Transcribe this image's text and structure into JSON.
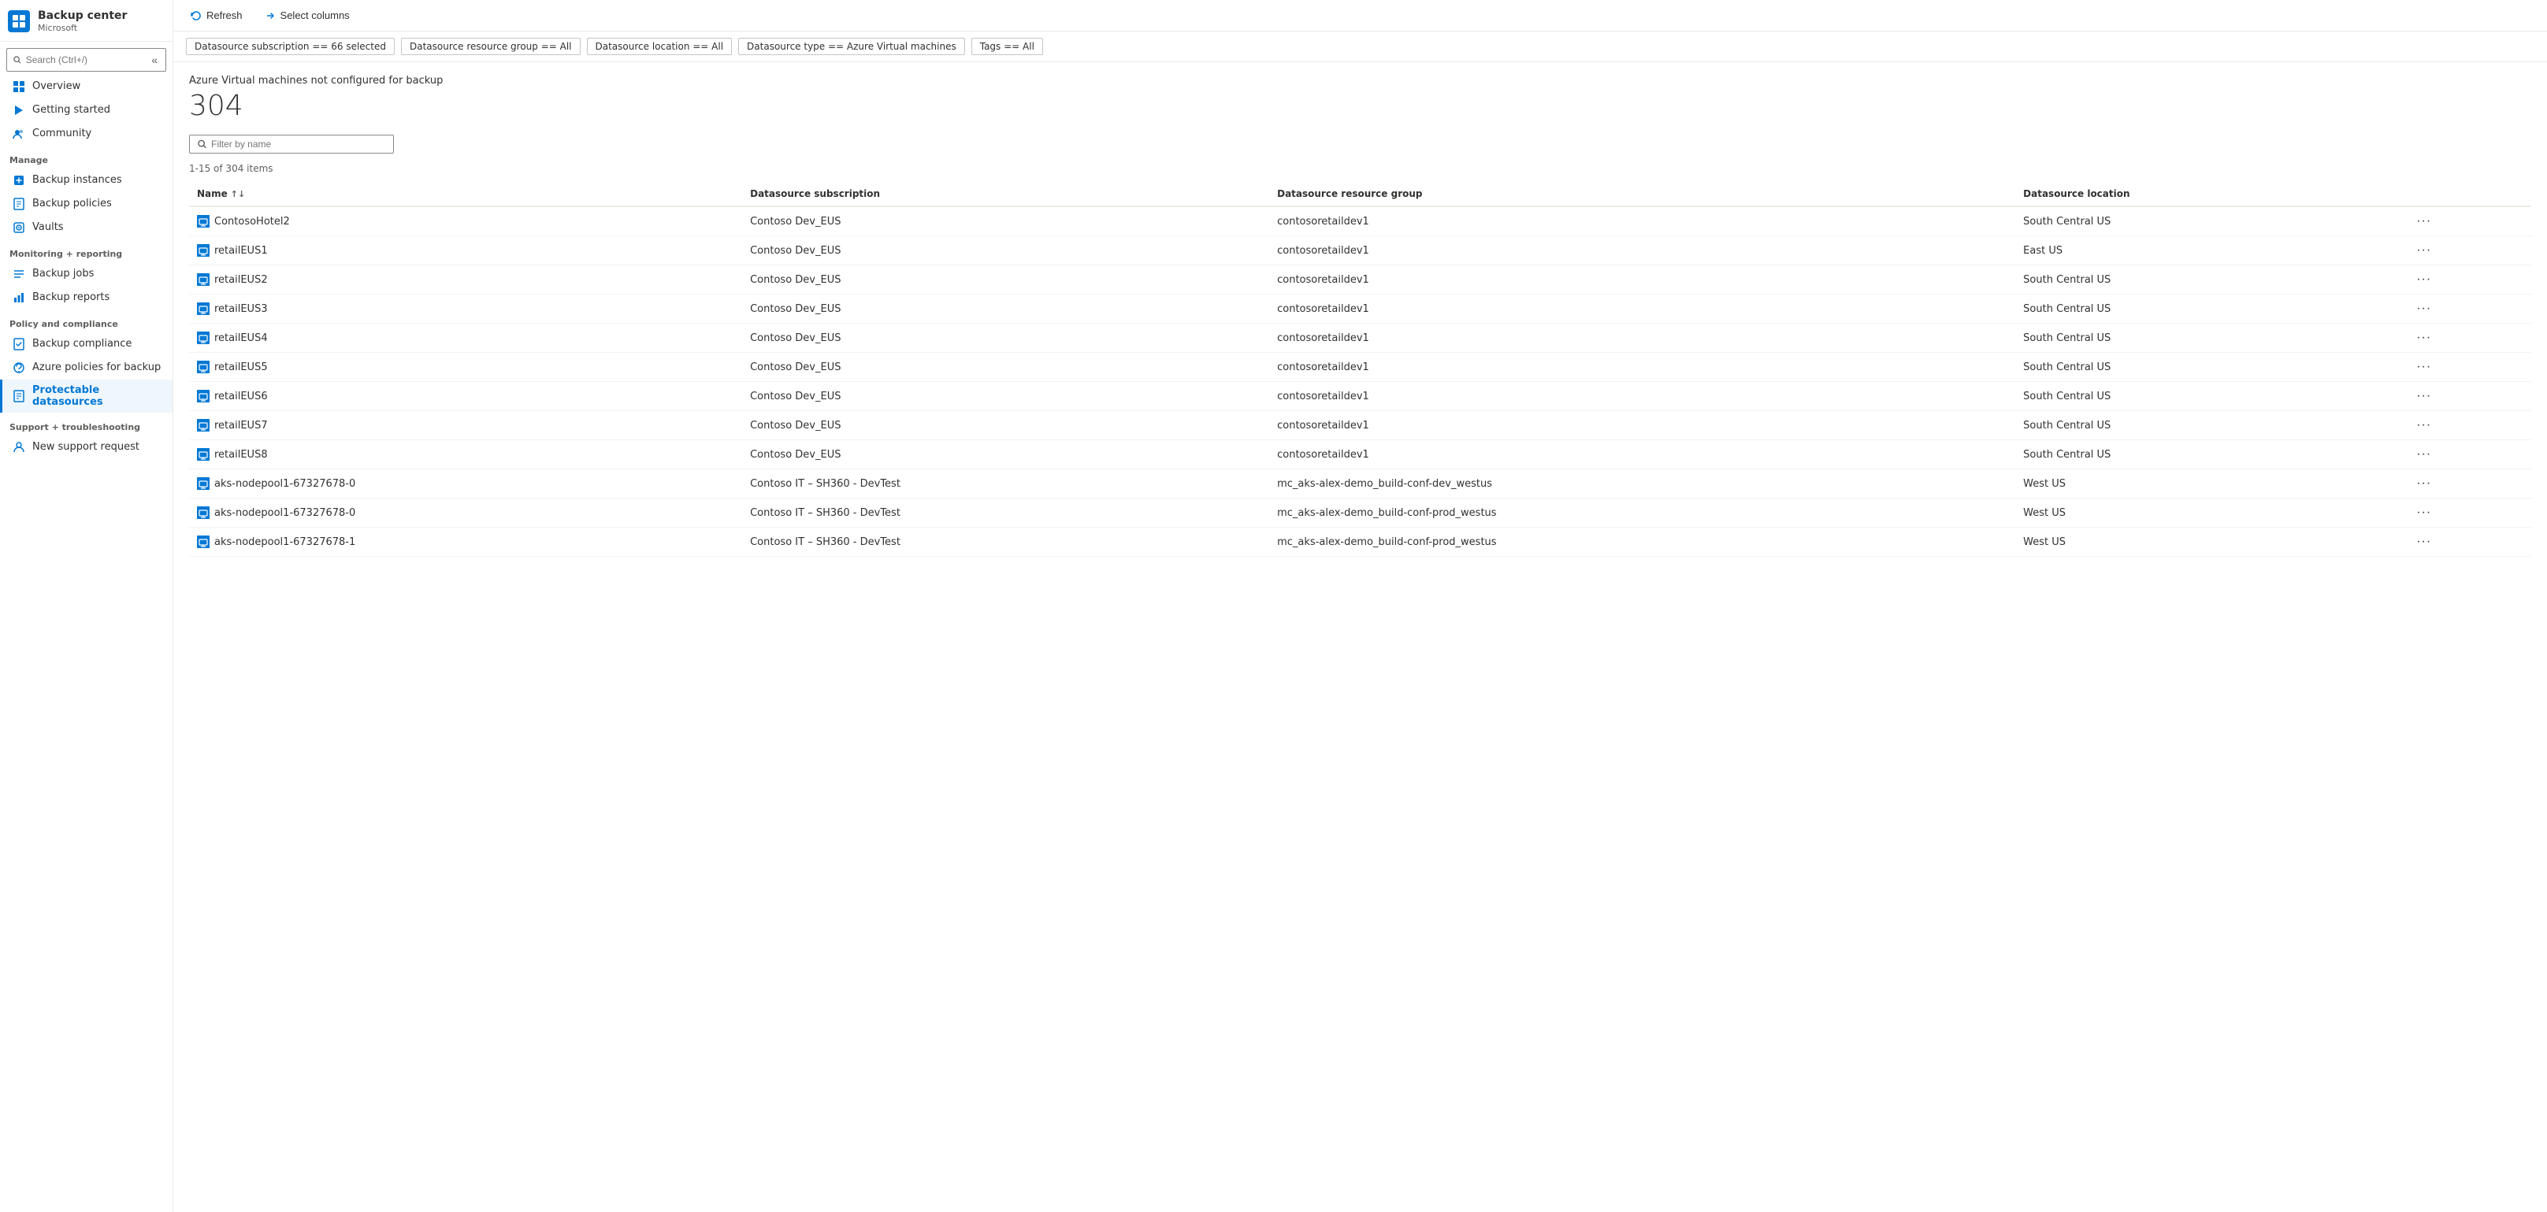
{
  "header": {
    "app_name": "Backup center",
    "page_title": "Protectable datasources",
    "app_subtitle": "Microsoft",
    "more_label": "···",
    "close_label": "✕"
  },
  "sidebar": {
    "search_placeholder": "Search (Ctrl+/)",
    "collapse_icon": "«",
    "sections": [
      {
        "items": [
          {
            "id": "overview",
            "label": "Overview",
            "icon": "⊞"
          },
          {
            "id": "getting-started",
            "label": "Getting started",
            "icon": "🚀"
          },
          {
            "id": "community",
            "label": "Community",
            "icon": "👥"
          }
        ]
      },
      {
        "label": "Manage",
        "items": [
          {
            "id": "backup-instances",
            "label": "Backup instances",
            "icon": "☁"
          },
          {
            "id": "backup-policies",
            "label": "Backup policies",
            "icon": "📋"
          },
          {
            "id": "vaults",
            "label": "Vaults",
            "icon": "🏦"
          }
        ]
      },
      {
        "label": "Monitoring + reporting",
        "items": [
          {
            "id": "backup-jobs",
            "label": "Backup jobs",
            "icon": "≡"
          },
          {
            "id": "backup-reports",
            "label": "Backup reports",
            "icon": "📊"
          }
        ]
      },
      {
        "label": "Policy and compliance",
        "items": [
          {
            "id": "backup-compliance",
            "label": "Backup compliance",
            "icon": "📄"
          },
          {
            "id": "azure-policies",
            "label": "Azure policies for backup",
            "icon": "⚙"
          },
          {
            "id": "protectable-datasources",
            "label": "Protectable datasources",
            "icon": "📋",
            "active": true
          }
        ]
      },
      {
        "label": "Support + troubleshooting",
        "items": [
          {
            "id": "new-support-request",
            "label": "New support request",
            "icon": "👤"
          }
        ]
      }
    ]
  },
  "toolbar": {
    "refresh_label": "Refresh",
    "select_columns_label": "Select columns"
  },
  "filters": [
    {
      "label": "Datasource subscription == 66 selected"
    },
    {
      "label": "Datasource resource group == All"
    },
    {
      "label": "Datasource location == All"
    },
    {
      "label": "Datasource type == Azure Virtual machines"
    },
    {
      "label": "Tags == All"
    }
  ],
  "content": {
    "section_title": "Azure Virtual machines not configured for backup",
    "count": "304",
    "filter_placeholder": "Filter by name",
    "items_count": "1-15 of 304 items",
    "table": {
      "columns": [
        {
          "label": "Name",
          "sortable": true
        },
        {
          "label": "Datasource subscription",
          "sortable": false
        },
        {
          "label": "Datasource resource group",
          "sortable": false
        },
        {
          "label": "Datasource location",
          "sortable": false
        }
      ],
      "rows": [
        {
          "name": "ContosoHotel2",
          "subscription": "Contoso Dev_EUS",
          "resource_group": "contosoretaildev1",
          "location": "South Central US"
        },
        {
          "name": "retailEUS1",
          "subscription": "Contoso Dev_EUS",
          "resource_group": "contosoretaildev1",
          "location": "East US"
        },
        {
          "name": "retailEUS2",
          "subscription": "Contoso Dev_EUS",
          "resource_group": "contosoretaildev1",
          "location": "South Central US"
        },
        {
          "name": "retailEUS3",
          "subscription": "Contoso Dev_EUS",
          "resource_group": "contosoretaildev1",
          "location": "South Central US"
        },
        {
          "name": "retailEUS4",
          "subscription": "Contoso Dev_EUS",
          "resource_group": "contosoretaildev1",
          "location": "South Central US"
        },
        {
          "name": "retailEUS5",
          "subscription": "Contoso Dev_EUS",
          "resource_group": "contosoretaildev1",
          "location": "South Central US"
        },
        {
          "name": "retailEUS6",
          "subscription": "Contoso Dev_EUS",
          "resource_group": "contosoretaildev1",
          "location": "South Central US"
        },
        {
          "name": "retailEUS7",
          "subscription": "Contoso Dev_EUS",
          "resource_group": "contosoretaildev1",
          "location": "South Central US"
        },
        {
          "name": "retailEUS8",
          "subscription": "Contoso Dev_EUS",
          "resource_group": "contosoretaildev1",
          "location": "South Central US"
        },
        {
          "name": "aks-nodepool1-67327678-0",
          "subscription": "Contoso IT – SH360 - DevTest",
          "resource_group": "mc_aks-alex-demo_build-conf-dev_westus",
          "location": "West US"
        },
        {
          "name": "aks-nodepool1-67327678-0",
          "subscription": "Contoso IT – SH360 - DevTest",
          "resource_group": "mc_aks-alex-demo_build-conf-prod_westus",
          "location": "West US"
        },
        {
          "name": "aks-nodepool1-67327678-1",
          "subscription": "Contoso IT – SH360 - DevTest",
          "resource_group": "mc_aks-alex-demo_build-conf-prod_westus",
          "location": "West US"
        }
      ]
    }
  }
}
